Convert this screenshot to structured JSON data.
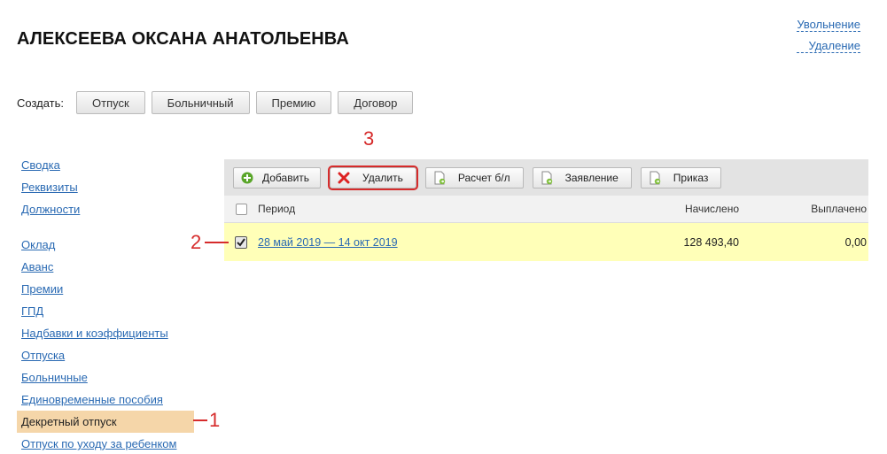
{
  "employee": {
    "name": "АЛЕКСЕЕВА ОКСАНА АНАТОЛЬЕНВА"
  },
  "top_links": {
    "dismissal": "Увольнение",
    "delete": "Удаление"
  },
  "create": {
    "label": "Создать:",
    "buttons": [
      "Отпуск",
      "Больничный",
      "Премию",
      "Договор"
    ]
  },
  "sidebar": {
    "group1": [
      "Сводка",
      "Реквизиты",
      "Должности"
    ],
    "group2": [
      "Оклад",
      "Аванс",
      "Премии",
      "ГПД",
      "Надбавки и коэффициенты",
      "Отпуска",
      "Больничные",
      "Единовременные пособия"
    ],
    "active": "Декретный отпуск",
    "after": [
      "Отпуск по уходу за ребенком"
    ]
  },
  "toolbar": {
    "add": "Добавить",
    "delete": "Удалить",
    "sick_calc": "Расчет б/л",
    "statement": "Заявление",
    "order": "Приказ"
  },
  "table": {
    "headers": {
      "period": "Период",
      "accrued": "Начислено",
      "paid": "Выплачено"
    },
    "rows": [
      {
        "period": "28 май 2019 — 14 окт 2019",
        "accrued": "128 493,40",
        "paid": "0,00",
        "checked": true
      }
    ]
  },
  "annotations": {
    "one": "1",
    "two": "2",
    "three": "3"
  },
  "colors": {
    "link": "#2a6ab3",
    "annotation": "#d62b2b",
    "selected_row": "#ffffb8",
    "active_side": "#f5d6a9"
  }
}
